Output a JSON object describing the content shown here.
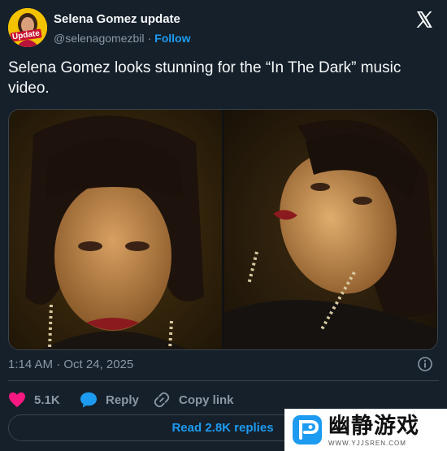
{
  "author": {
    "name": "Selena Gomez update",
    "handle": "@selenagomezbil",
    "separator": "·",
    "follow_label": "Follow",
    "avatar_badge": "Update"
  },
  "tweet": {
    "text": "Selena Gomez looks stunning for the “In The Dark” music video.",
    "timestamp": "1:14 AM · Oct 24, 2025"
  },
  "actions": {
    "like_count": "5.1K",
    "reply_label": "Reply",
    "copy_label": "Copy link",
    "read_replies_label": "Read 2.8K replies"
  },
  "watermark": {
    "brand_text": "幽静游戏",
    "url_text": "WWW.YJJSREN.COM"
  },
  "colors": {
    "background": "#15202b",
    "accent": "#1d9bf0",
    "like_pink": "#f91880",
    "muted": "#8b98a5",
    "border": "#38444d"
  },
  "icons": [
    "x-logo-icon",
    "info-icon",
    "heart-icon",
    "reply-bubble-icon",
    "link-icon",
    "watermark-logo-icon"
  ]
}
